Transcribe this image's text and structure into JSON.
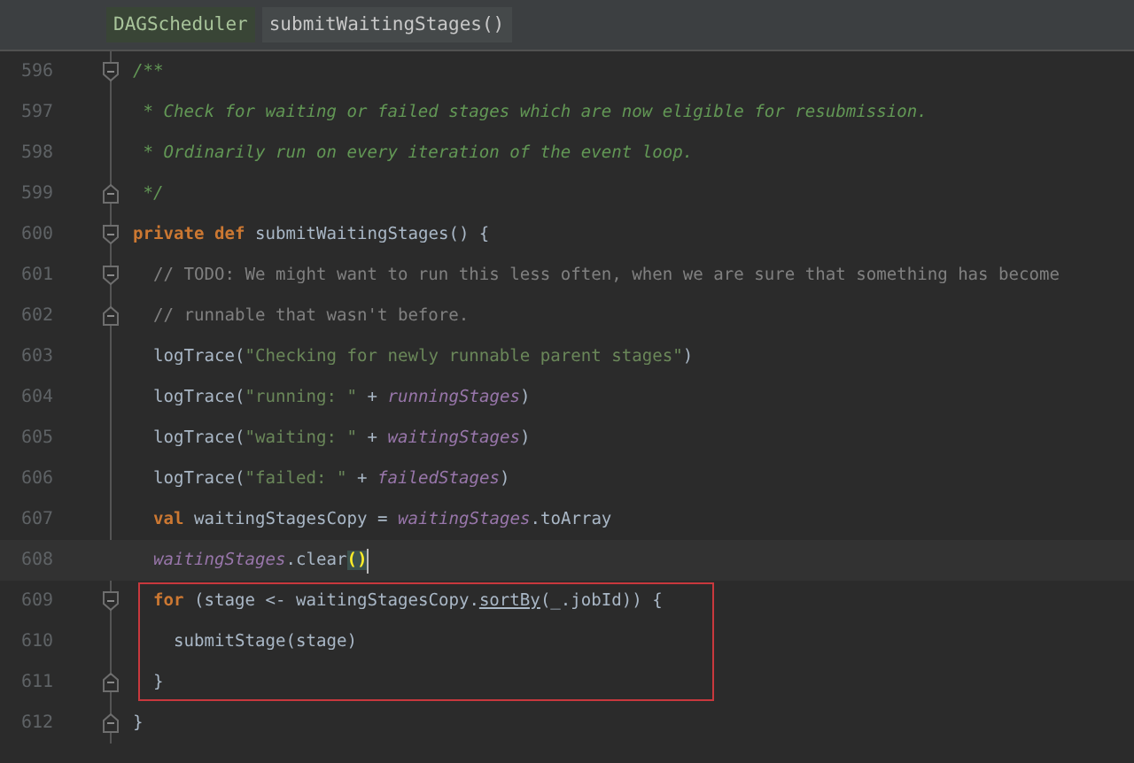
{
  "breadcrumbs": [
    {
      "label": "DAGScheduler",
      "kind": "class"
    },
    {
      "label": "submitWaitingStages()",
      "kind": "method"
    }
  ],
  "lines": [
    {
      "number": "596",
      "fold_start": true,
      "fold_end": false,
      "current": false,
      "boxed": false,
      "tokens": [
        {
          "kind": "doc",
          "text": "/**"
        }
      ]
    },
    {
      "number": "597",
      "fold_start": false,
      "fold_end": false,
      "current": false,
      "boxed": false,
      "tokens": [
        {
          "kind": "doc",
          "text": " * Check for waiting or failed stages which are now eligible for resubmission."
        }
      ]
    },
    {
      "number": "598",
      "fold_start": false,
      "fold_end": false,
      "current": false,
      "boxed": false,
      "tokens": [
        {
          "kind": "doc",
          "text": " * Ordinarily run on every iteration of the event loop."
        }
      ]
    },
    {
      "number": "599",
      "fold_start": false,
      "fold_end": true,
      "current": false,
      "boxed": false,
      "tokens": [
        {
          "kind": "doc",
          "text": " */"
        }
      ]
    },
    {
      "number": "600",
      "fold_start": true,
      "fold_end": false,
      "current": false,
      "boxed": false,
      "tokens": [
        {
          "kind": "keyword",
          "text": "private def "
        },
        {
          "kind": "plain",
          "text": "submitWaitingStages() {"
        }
      ]
    },
    {
      "number": "601",
      "fold_start": true,
      "fold_end": false,
      "current": false,
      "boxed": false,
      "tokens": [
        {
          "kind": "comment",
          "text": "  // TODO: We might want to run this less often, when we are sure that something has become"
        }
      ]
    },
    {
      "number": "602",
      "fold_start": false,
      "fold_end": true,
      "current": false,
      "boxed": false,
      "tokens": [
        {
          "kind": "comment",
          "text": "  // runnable that wasn't before."
        }
      ]
    },
    {
      "number": "603",
      "fold_start": false,
      "fold_end": false,
      "current": false,
      "boxed": false,
      "tokens": [
        {
          "kind": "plain",
          "text": "  logTrace("
        },
        {
          "kind": "string",
          "text": "\"Checking for newly runnable parent stages\""
        },
        {
          "kind": "plain",
          "text": ")"
        }
      ]
    },
    {
      "number": "604",
      "fold_start": false,
      "fold_end": false,
      "current": false,
      "boxed": false,
      "tokens": [
        {
          "kind": "plain",
          "text": "  logTrace("
        },
        {
          "kind": "string",
          "text": "\"running: \""
        },
        {
          "kind": "plain",
          "text": " + "
        },
        {
          "kind": "field",
          "text": "runningStages"
        },
        {
          "kind": "plain",
          "text": ")"
        }
      ]
    },
    {
      "number": "605",
      "fold_start": false,
      "fold_end": false,
      "current": false,
      "boxed": false,
      "tokens": [
        {
          "kind": "plain",
          "text": "  logTrace("
        },
        {
          "kind": "string",
          "text": "\"waiting: \""
        },
        {
          "kind": "plain",
          "text": " + "
        },
        {
          "kind": "field",
          "text": "waitingStages"
        },
        {
          "kind": "plain",
          "text": ")"
        }
      ]
    },
    {
      "number": "606",
      "fold_start": false,
      "fold_end": false,
      "current": false,
      "boxed": false,
      "tokens": [
        {
          "kind": "plain",
          "text": "  logTrace("
        },
        {
          "kind": "string",
          "text": "\"failed: \""
        },
        {
          "kind": "plain",
          "text": " + "
        },
        {
          "kind": "field",
          "text": "failedStages"
        },
        {
          "kind": "plain",
          "text": ")"
        }
      ]
    },
    {
      "number": "607",
      "fold_start": false,
      "fold_end": false,
      "current": false,
      "boxed": false,
      "tokens": [
        {
          "kind": "keyword",
          "text": "  val "
        },
        {
          "kind": "plain",
          "text": "waitingStagesCopy = "
        },
        {
          "kind": "field",
          "text": "waitingStages"
        },
        {
          "kind": "plain",
          "text": ".toArray"
        }
      ]
    },
    {
      "number": "608",
      "fold_start": false,
      "fold_end": false,
      "current": true,
      "boxed": false,
      "tokens": [
        {
          "kind": "field",
          "text": "  waitingStages"
        },
        {
          "kind": "plain",
          "text": ".clear"
        },
        {
          "kind": "brace",
          "text": "()"
        }
      ]
    },
    {
      "number": "609",
      "fold_start": true,
      "fold_end": false,
      "current": false,
      "boxed": true,
      "tokens": [
        {
          "kind": "keyword",
          "text": "  for "
        },
        {
          "kind": "plain",
          "text": "(stage <- waitingStagesCopy."
        },
        {
          "kind": "underlined",
          "text": "sortBy"
        },
        {
          "kind": "plain",
          "text": "(_.jobId)) {"
        }
      ]
    },
    {
      "number": "610",
      "fold_start": false,
      "fold_end": false,
      "current": false,
      "boxed": true,
      "tokens": [
        {
          "kind": "plain",
          "text": "    submitStage(stage)"
        }
      ]
    },
    {
      "number": "611",
      "fold_start": false,
      "fold_end": true,
      "current": false,
      "boxed": true,
      "tokens": [
        {
          "kind": "plain",
          "text": "  }"
        }
      ]
    },
    {
      "number": "612",
      "fold_start": false,
      "fold_end": true,
      "current": false,
      "boxed": false,
      "tokens": [
        {
          "kind": "plain",
          "text": "}"
        }
      ]
    }
  ]
}
